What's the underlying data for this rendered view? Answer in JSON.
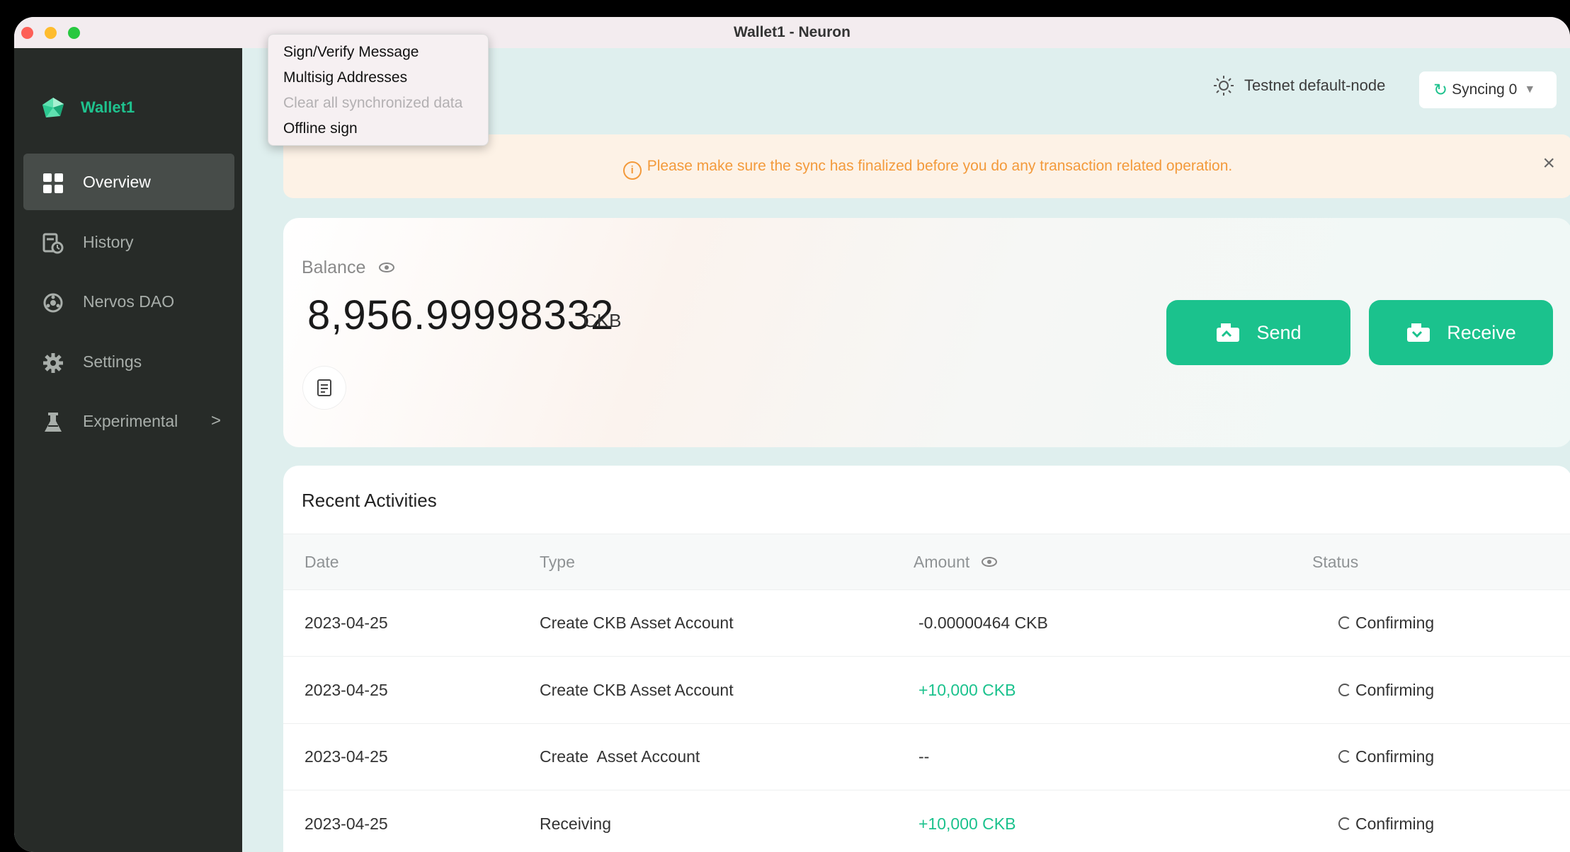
{
  "window": {
    "title": "Wallet1 - Neuron"
  },
  "context_menu": {
    "items": [
      {
        "label": "Sign/Verify Message",
        "enabled": true
      },
      {
        "label": "Multisig Addresses",
        "enabled": true
      },
      {
        "label": "Clear all synchronized data",
        "enabled": false
      },
      {
        "label": "Offline sign",
        "enabled": true
      }
    ]
  },
  "sidebar": {
    "wallet_name": "Wallet1",
    "items": [
      {
        "label": "Overview",
        "icon": "grid-icon",
        "active": true
      },
      {
        "label": "History",
        "icon": "history-icon"
      },
      {
        "label": "Nervos DAO",
        "icon": "dao-icon"
      },
      {
        "label": "Settings",
        "icon": "gear-icon"
      },
      {
        "label": "Experimental",
        "icon": "flask-icon",
        "has_submenu": true
      }
    ],
    "chevron": ">"
  },
  "header": {
    "network": "Testnet default-node",
    "sync_label": "Syncing 0"
  },
  "alert": {
    "text": "Please make sure the sync has finalized before you do any transaction related operation.",
    "close": "×"
  },
  "balance": {
    "label": "Balance",
    "amount": "8,956.99998332",
    "unit": "CKB",
    "send_label": "Send",
    "receive_label": "Receive"
  },
  "activities": {
    "title": "Recent Activities",
    "columns": {
      "date": "Date",
      "type": "Type",
      "amount": "Amount",
      "status": "Status"
    },
    "rows": [
      {
        "date": "2023-04-25",
        "type": "Create CKB Asset Account",
        "amount": "-0.00000464 CKB",
        "status": "Confirming"
      },
      {
        "date": "2023-04-25",
        "type": "Create CKB Asset Account",
        "amount": "+10,000 CKB",
        "status": "Confirming"
      },
      {
        "date": "2023-04-25",
        "type": "Create  Asset Account",
        "amount": "--",
        "status": "Confirming"
      },
      {
        "date": "2023-04-25",
        "type": "Receiving",
        "amount": "+10,000 CKB",
        "status": "Confirming"
      }
    ]
  },
  "colors": {
    "brand": "#1bc28d",
    "sidebar_bg": "#272b28",
    "main_bg": "#dfefee",
    "warning": "#f39a3b"
  }
}
